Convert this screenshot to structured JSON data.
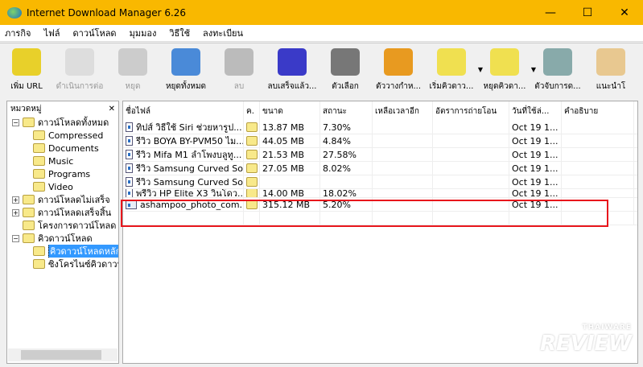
{
  "window": {
    "title": "Internet Download Manager 6.26",
    "minimize": "—",
    "maximize": "☐",
    "close": "✕"
  },
  "menu": [
    "ภารกิจ",
    "ไฟล์",
    "ดาวน์โหลด",
    "มุมมอง",
    "วิธีใช้",
    "ลงทะเบียน"
  ],
  "toolbar": [
    {
      "label": "เพิ่ม URL",
      "enabled": true,
      "color": "#e8d02a"
    },
    {
      "label": "ดำเนินการต่อ",
      "enabled": false,
      "color": "#ddd"
    },
    {
      "label": "หยุด",
      "enabled": false,
      "color": "#ccc"
    },
    {
      "label": "หยุดทั้งหมด",
      "enabled": true,
      "color": "#4a8ad8"
    },
    {
      "label": "ลบ",
      "enabled": false,
      "color": "#bbb"
    },
    {
      "label": "ลบเสร็จแล้ว...",
      "enabled": true,
      "color": "#3a3ac8"
    },
    {
      "label": "ตัวเลือก",
      "enabled": true,
      "color": "#777"
    },
    {
      "label": "ตัววางกำห...",
      "enabled": true,
      "color": "#e89a20"
    },
    {
      "label": "เริ่มคิวดาว...",
      "enabled": true,
      "color": "#f0e050"
    },
    {
      "label": "หยุดคิวดา...",
      "enabled": true,
      "color": "#f0e050"
    },
    {
      "label": "ตัวจับการด...",
      "enabled": true,
      "color": "#8aa"
    },
    {
      "label": "แนะนำโ",
      "enabled": true,
      "color": "#e8c890"
    }
  ],
  "sidebar": {
    "title": "หมวดหมู่",
    "close": "✕",
    "tree": [
      {
        "label": "ดาวน์โหลดทั้งหมด",
        "level": 0,
        "toggle": "−"
      },
      {
        "label": "Compressed",
        "level": 1
      },
      {
        "label": "Documents",
        "level": 1
      },
      {
        "label": "Music",
        "level": 1
      },
      {
        "label": "Programs",
        "level": 1
      },
      {
        "label": "Video",
        "level": 1
      },
      {
        "label": "ดาวน์โหลดไม่เสร็จ",
        "level": 0,
        "toggle": "+"
      },
      {
        "label": "ดาวน์โหลดเสร็จสิ้น",
        "level": 0,
        "toggle": "+"
      },
      {
        "label": "โครงการดาวน์โหลด",
        "level": 0
      },
      {
        "label": "คิวดาวน์โหลด",
        "level": 0,
        "toggle": "−"
      },
      {
        "label": "คิวดาวน์โหลดหลัก",
        "level": 1,
        "selected": true
      },
      {
        "label": "ซิงโครไนซ์คิวดาวน์",
        "level": 1
      }
    ]
  },
  "list": {
    "columns": [
      "ชื่อไฟล์",
      "ค.",
      "ขนาด",
      "สถานะ",
      "เหลือเวลาอีก",
      "อัตราการถ่ายโอน",
      "วันที่ใช้ล่...",
      "คำอธิบาย"
    ],
    "rows": [
      {
        "name": "ทิปส์ วิธีใช้ Siri ช่วยหารูป...",
        "size": "13.87 MB",
        "status": "7.30%",
        "date": "Oct 19 1..."
      },
      {
        "name": "รีวิว BOYA BY-PVM50 ไม...",
        "size": "44.05 MB",
        "status": "4.84%",
        "date": "Oct 19 1..."
      },
      {
        "name": "รีวิว Mifa M1 ลำโพงบลูทู...",
        "size": "21.53 MB",
        "status": "27.58%",
        "date": "Oct 19 1..."
      },
      {
        "name": "รีวิว Samsung Curved So...",
        "size": "27.05 MB",
        "status": "8.02%",
        "date": "Oct 19 1..."
      },
      {
        "name": "รีวิว Samsung Curved So...",
        "size": "",
        "status": "",
        "date": "Oct 19 1..."
      },
      {
        "name": "พรีวิว HP Elite X3 วินโดว...",
        "size": "14.00 MB",
        "status": "18.02%",
        "date": "Oct 19 1..."
      },
      {
        "name": "ashampoo_photo_com...",
        "size": "315.12 MB",
        "status": "5.20%",
        "date": "Oct 19 1...",
        "highlight": true
      }
    ]
  },
  "watermark": {
    "top": "THAIWARE",
    "bottom": "REVIEW"
  }
}
